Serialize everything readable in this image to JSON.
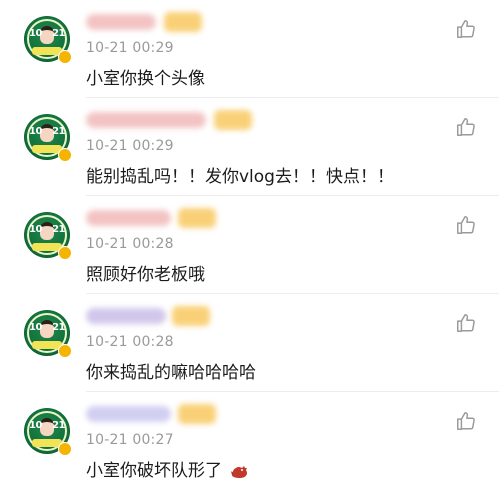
{
  "comments": [
    {
      "time": "10-21 00:29",
      "text": "小室你换个头像",
      "avatar_number": "10 21",
      "icon": "thumbs-up-icon",
      "name_blur_color": "#f1b9b9",
      "name_blur_width": 70
    },
    {
      "time": "10-21 00:29",
      "text": "能别捣乱吗！！发你vlog去！！快点！！",
      "avatar_number": "10 21",
      "icon": "thumbs-up-icon",
      "name_blur_color": "#f1b9b9",
      "name_blur_width": 120
    },
    {
      "time": "10-21 00:28",
      "text": "照顾好你老板哦",
      "avatar_number": "10 21",
      "icon": "thumbs-up-icon",
      "name_blur_color": "#f1b9b9",
      "name_blur_width": 85
    },
    {
      "time": "10-21 00:28",
      "text": "你来捣乱的嘛哈哈哈哈",
      "avatar_number": "10 21",
      "icon": "thumbs-up-icon",
      "name_blur_color": "#c9bde8",
      "name_blur_width": 80
    },
    {
      "time": "10-21 00:27",
      "text": "小室你破坏队形了",
      "avatar_number": "10 21",
      "icon": "thumbs-up-icon",
      "name_blur_color": "#c9c6f0",
      "name_blur_width": 85,
      "trailing_emoji": "dragon-emoji"
    }
  ],
  "colors": {
    "time": "#9a9a9a",
    "text": "#1b1b1b",
    "badge": "#f7c14a",
    "avatar_green": "#0f6b38"
  }
}
